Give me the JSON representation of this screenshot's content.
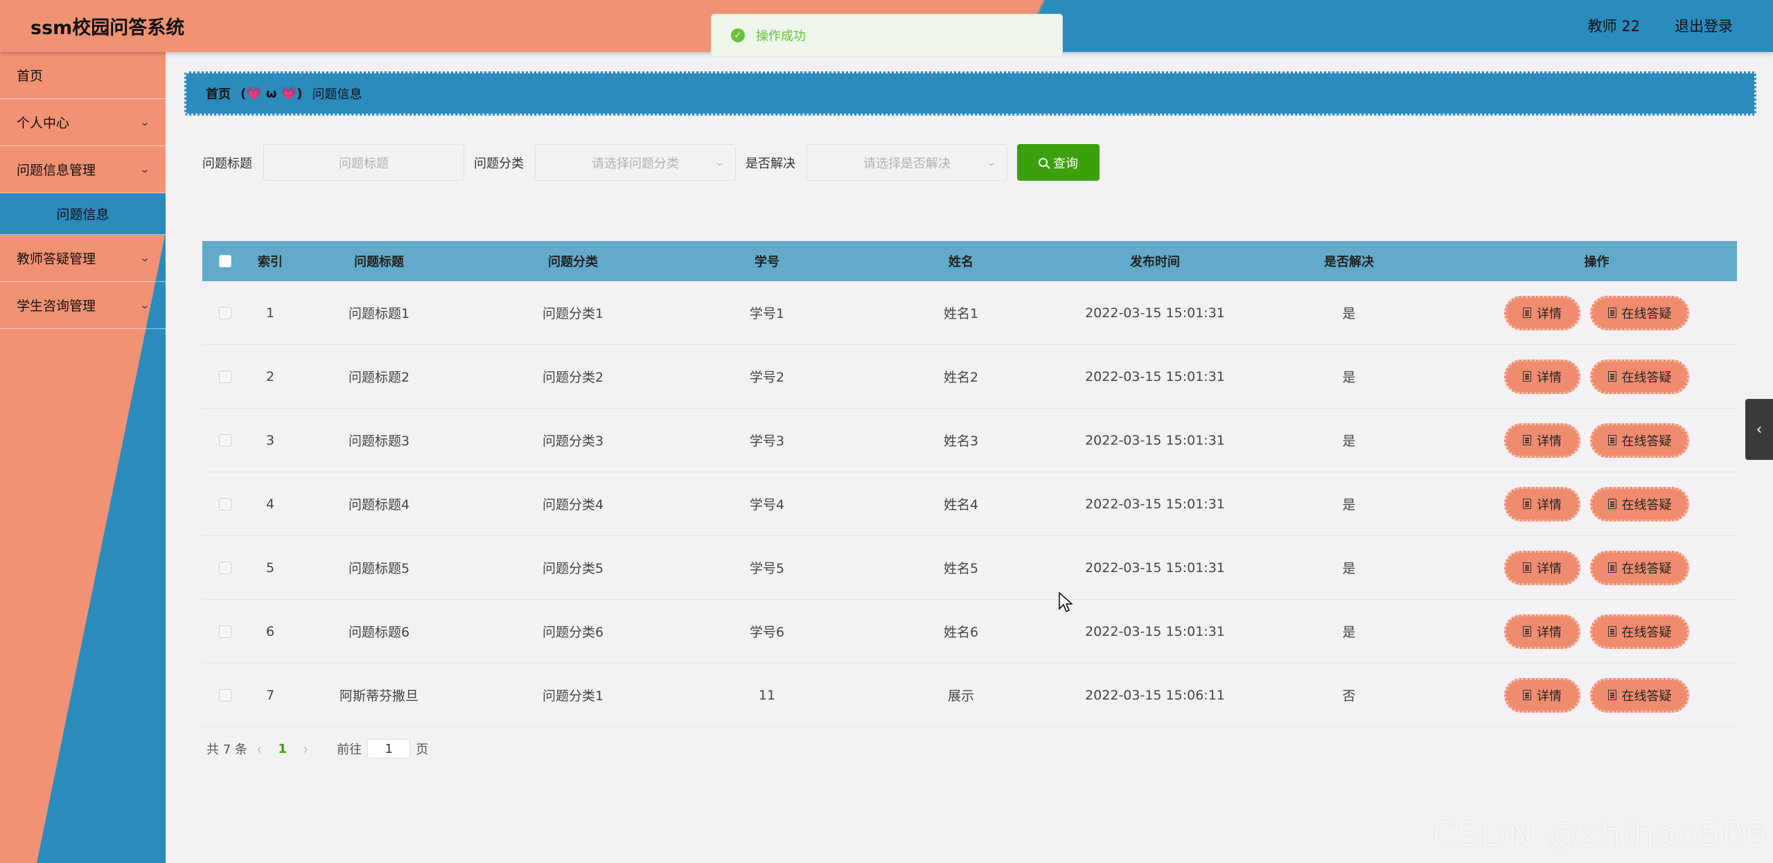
{
  "header": {
    "app_title": "ssm校园问答系统",
    "user_name": "教师 22",
    "logout": "退出登录"
  },
  "toast": {
    "icon": "check-circle-icon",
    "text": "操作成功"
  },
  "sidebar": {
    "items": [
      {
        "label": "首页"
      },
      {
        "label": "个人中心"
      },
      {
        "label": "问题信息管理"
      },
      {
        "label": "问题信息"
      },
      {
        "label": "教师答疑管理"
      },
      {
        "label": "学生咨询管理"
      }
    ]
  },
  "breadcrumb": {
    "home": "首页",
    "separator": "(💗 ω 💗)",
    "current": "问题信息"
  },
  "search": {
    "title_label": "问题标题",
    "title_placeholder": "问题标题",
    "category_label": "问题分类",
    "category_placeholder": "请选择问题分类",
    "solved_label": "是否解决",
    "solved_placeholder": "请选择是否解决",
    "query_button": "查询"
  },
  "table": {
    "headers": [
      "索引",
      "问题标题",
      "问题分类",
      "学号",
      "姓名",
      "发布时间",
      "是否解决",
      "操作"
    ],
    "detail_button": "详情",
    "answer_button": "在线答疑",
    "rows": [
      {
        "idx": "1",
        "title": "问题标题1",
        "category": "问题分类1",
        "student_no": "学号1",
        "name": "姓名1",
        "time": "2022-03-15 15:01:31",
        "solved": "是"
      },
      {
        "idx": "2",
        "title": "问题标题2",
        "category": "问题分类2",
        "student_no": "学号2",
        "name": "姓名2",
        "time": "2022-03-15 15:01:31",
        "solved": "是"
      },
      {
        "idx": "3",
        "title": "问题标题3",
        "category": "问题分类3",
        "student_no": "学号3",
        "name": "姓名3",
        "time": "2022-03-15 15:01:31",
        "solved": "是"
      },
      {
        "idx": "4",
        "title": "问题标题4",
        "category": "问题分类4",
        "student_no": "学号4",
        "name": "姓名4",
        "time": "2022-03-15 15:01:31",
        "solved": "是"
      },
      {
        "idx": "5",
        "title": "问题标题5",
        "category": "问题分类5",
        "student_no": "学号5",
        "name": "姓名5",
        "time": "2022-03-15 15:01:31",
        "solved": "是"
      },
      {
        "idx": "6",
        "title": "问题标题6",
        "category": "问题分类6",
        "student_no": "学号6",
        "name": "姓名6",
        "time": "2022-03-15 15:01:31",
        "solved": "是"
      },
      {
        "idx": "7",
        "title": "阿斯蒂芬撒旦",
        "category": "问题分类1",
        "student_no": "11",
        "name": "展示",
        "time": "2022-03-15 15:06:11",
        "solved": "否"
      }
    ]
  },
  "pagination": {
    "total": "共 7 条",
    "current_page": "1",
    "goto_label": "前往",
    "goto_value": "1",
    "page_suffix": "页"
  },
  "watermark": "CSDN @zhihao506",
  "colors": {
    "salmon": "#f29274",
    "blue": "#2b8bbd",
    "table_header": "#62aaca",
    "query_green": "#3aa00c",
    "op_button": "#ef8c6f"
  }
}
